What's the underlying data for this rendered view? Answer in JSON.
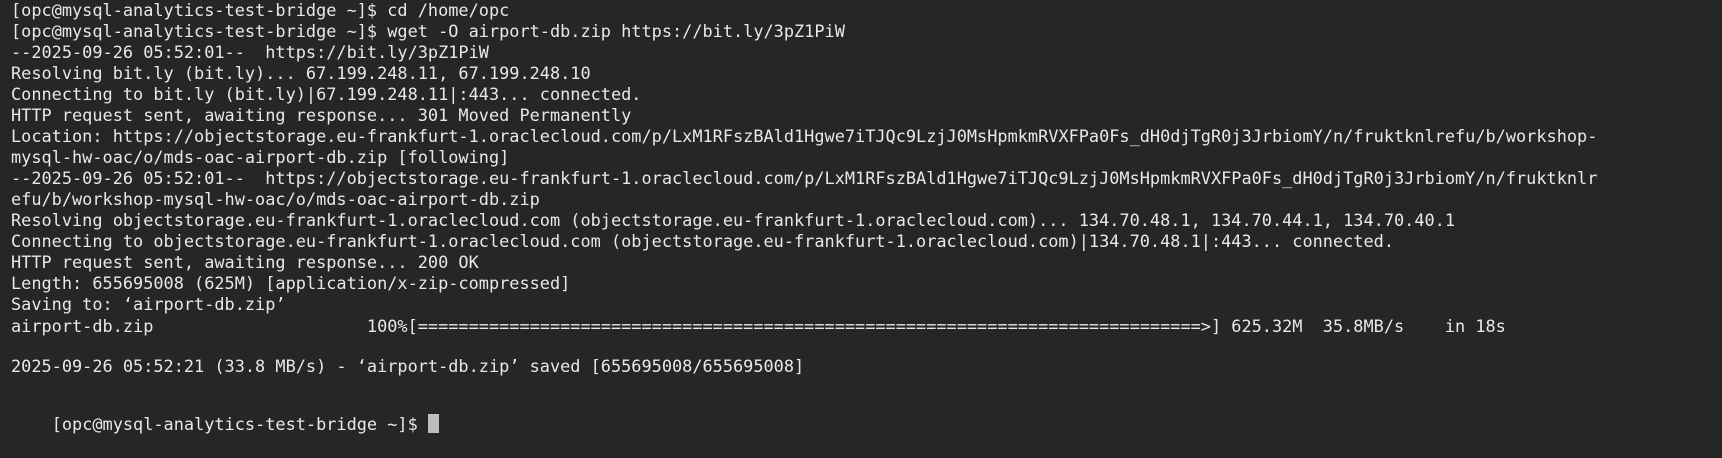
{
  "terminal": {
    "lines": [
      "[opc@mysql-analytics-test-bridge ~]$ cd /home/opc",
      "[opc@mysql-analytics-test-bridge ~]$ wget -O airport-db.zip https://bit.ly/3pZ1PiW",
      "--2025-09-26 05:52:01--  https://bit.ly/3pZ1PiW",
      "Resolving bit.ly (bit.ly)... 67.199.248.11, 67.199.248.10",
      "Connecting to bit.ly (bit.ly)|67.199.248.11|:443... connected.",
      "HTTP request sent, awaiting response... 301 Moved Permanently",
      "Location: https://objectstorage.eu-frankfurt-1.oraclecloud.com/p/LxM1RFszBAld1Hgwe7iTJQc9LzjJ0MsHpmkmRVXFPa0Fs_dH0djTgR0j3JrbiomY/n/fruktknlrefu/b/workshop-",
      "mysql-hw-oac/o/mds-oac-airport-db.zip [following]",
      "--2025-09-26 05:52:01--  https://objectstorage.eu-frankfurt-1.oraclecloud.com/p/LxM1RFszBAld1Hgwe7iTJQc9LzjJ0MsHpmkmRVXFPa0Fs_dH0djTgR0j3JrbiomY/n/fruktknlr",
      "efu/b/workshop-mysql-hw-oac/o/mds-oac-airport-db.zip",
      "Resolving objectstorage.eu-frankfurt-1.oraclecloud.com (objectstorage.eu-frankfurt-1.oraclecloud.com)... 134.70.48.1, 134.70.44.1, 134.70.40.1",
      "Connecting to objectstorage.eu-frankfurt-1.oraclecloud.com (objectstorage.eu-frankfurt-1.oraclecloud.com)|134.70.48.1|:443... connected.",
      "HTTP request sent, awaiting response... 200 OK",
      "Length: 655695008 (625M) [application/x-zip-compressed]",
      "Saving to: ‘airport-db.zip’",
      "",
      "airport-db.zip                     100%[=============================================================================>] 625.32M  35.8MB/s    in 18s",
      "",
      "2025-09-26 05:52:21 (33.8 MB/s) - ‘airport-db.zip’ saved [655695008/655695008]",
      ""
    ],
    "prompt": "[opc@mysql-analytics-test-bridge ~]$ "
  }
}
